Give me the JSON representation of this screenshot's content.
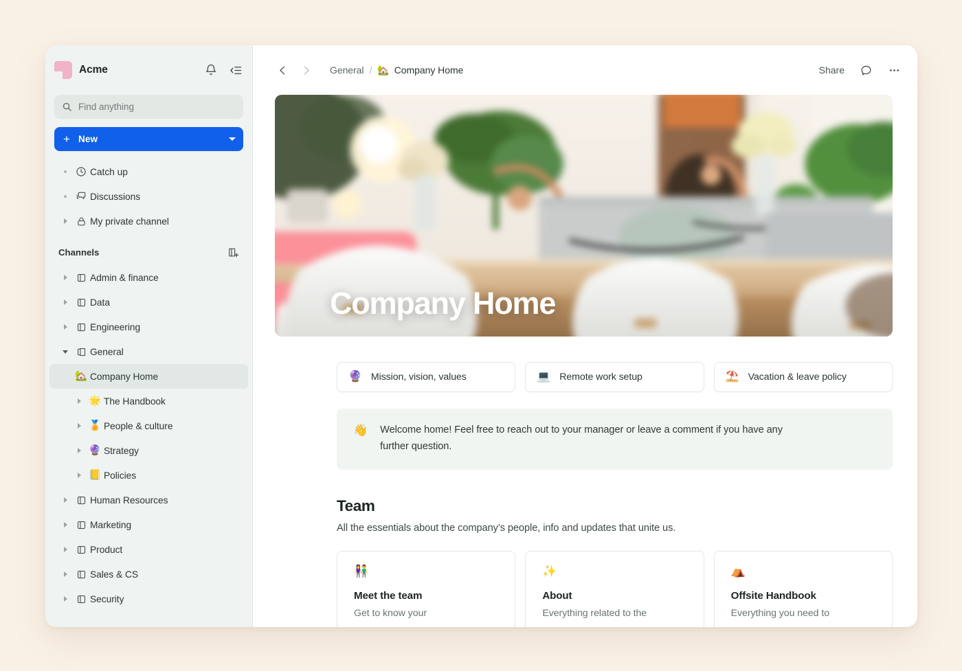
{
  "workspace": {
    "name": "Acme",
    "logo_color": "#f0b4c6"
  },
  "sidebar": {
    "notifications_icon": "bell-icon",
    "collapse_icon": "collapse-sidebar-icon",
    "search": {
      "placeholder": "Find anything",
      "value": "",
      "icon": "search-icon"
    },
    "new_button": {
      "label": "New",
      "plus_icon": "plus-icon",
      "caret_icon": "chevron-down-icon",
      "color": "#1160ea"
    },
    "top_items": [
      {
        "label": "Catch up",
        "icon": "clock-icon",
        "marker": "dot"
      },
      {
        "label": "Discussions",
        "icon": "chat-bubbles-icon",
        "marker": "dot"
      },
      {
        "label": "My private channel",
        "icon": "lock-icon",
        "marker": "triangle-right"
      }
    ],
    "channels_section": {
      "title": "Channels",
      "add_icon": "add-channel-icon"
    },
    "channels": [
      {
        "label": "Admin & finance",
        "icon": "channel-icon",
        "marker": "triangle-right",
        "expanded": false
      },
      {
        "label": "Data",
        "icon": "channel-icon",
        "marker": "triangle-right",
        "expanded": false
      },
      {
        "label": "Engineering",
        "icon": "channel-icon",
        "marker": "triangle-right",
        "expanded": false
      },
      {
        "label": "General",
        "icon": "channel-icon",
        "marker": "triangle-down",
        "expanded": true
      }
    ],
    "general_children": [
      {
        "label": "Company Home",
        "emoji": "🏡",
        "selected": true,
        "marker": "none"
      },
      {
        "label": "The Handbook",
        "emoji": "🌟",
        "selected": false,
        "marker": "triangle-right"
      },
      {
        "label": "People & culture",
        "emoji": "🏅",
        "selected": false,
        "marker": "triangle-right"
      },
      {
        "label": "Strategy",
        "emoji": "🔮",
        "selected": false,
        "marker": "triangle-right"
      },
      {
        "label": "Policies",
        "emoji": "📒",
        "selected": false,
        "marker": "triangle-right"
      }
    ],
    "channels_rest": [
      {
        "label": "Human Resources",
        "icon": "channel-icon",
        "marker": "triangle-right"
      },
      {
        "label": "Marketing",
        "icon": "channel-icon",
        "marker": "triangle-right"
      },
      {
        "label": "Product",
        "icon": "channel-icon",
        "marker": "triangle-right"
      },
      {
        "label": "Sales & CS",
        "icon": "channel-icon",
        "marker": "triangle-right"
      },
      {
        "label": "Security",
        "icon": "channel-icon",
        "marker": "triangle-right"
      }
    ]
  },
  "topbar": {
    "back_icon": "chevron-left-icon",
    "forward_icon": "chevron-right-icon",
    "breadcrumb": {
      "parent": "General",
      "separator": "/",
      "current_emoji": "🏡",
      "current": "Company Home"
    },
    "share_label": "Share",
    "comment_icon": "comment-icon",
    "more_icon": "more-options-icon"
  },
  "hero": {
    "title": "Company Home",
    "image_description": "blurred photo of a modern office meeting room with a wooden table, white chairs, plants and flowers"
  },
  "quick_links": [
    {
      "emoji": "🔮",
      "label": "Mission, vision, values"
    },
    {
      "emoji": "💻",
      "label": "Remote work setup"
    },
    {
      "emoji": "⛱️",
      "label": "Vacation & leave policy"
    }
  ],
  "callout": {
    "emoji": "👋",
    "text": "Welcome home! Feel free to reach out to your manager or leave a comment if you have any further question."
  },
  "team_section": {
    "title": "Team",
    "subtitle": "All the essentials about the company’s people, info and updates that unite us.",
    "cards": [
      {
        "emoji": "👫",
        "title": "Meet the team",
        "description": "Get to know your"
      },
      {
        "emoji": "✨",
        "title": "About",
        "description": "Everything related to the"
      },
      {
        "emoji": "⛺",
        "title": "Offsite Handbook",
        "description": "Everything you need to"
      }
    ]
  }
}
